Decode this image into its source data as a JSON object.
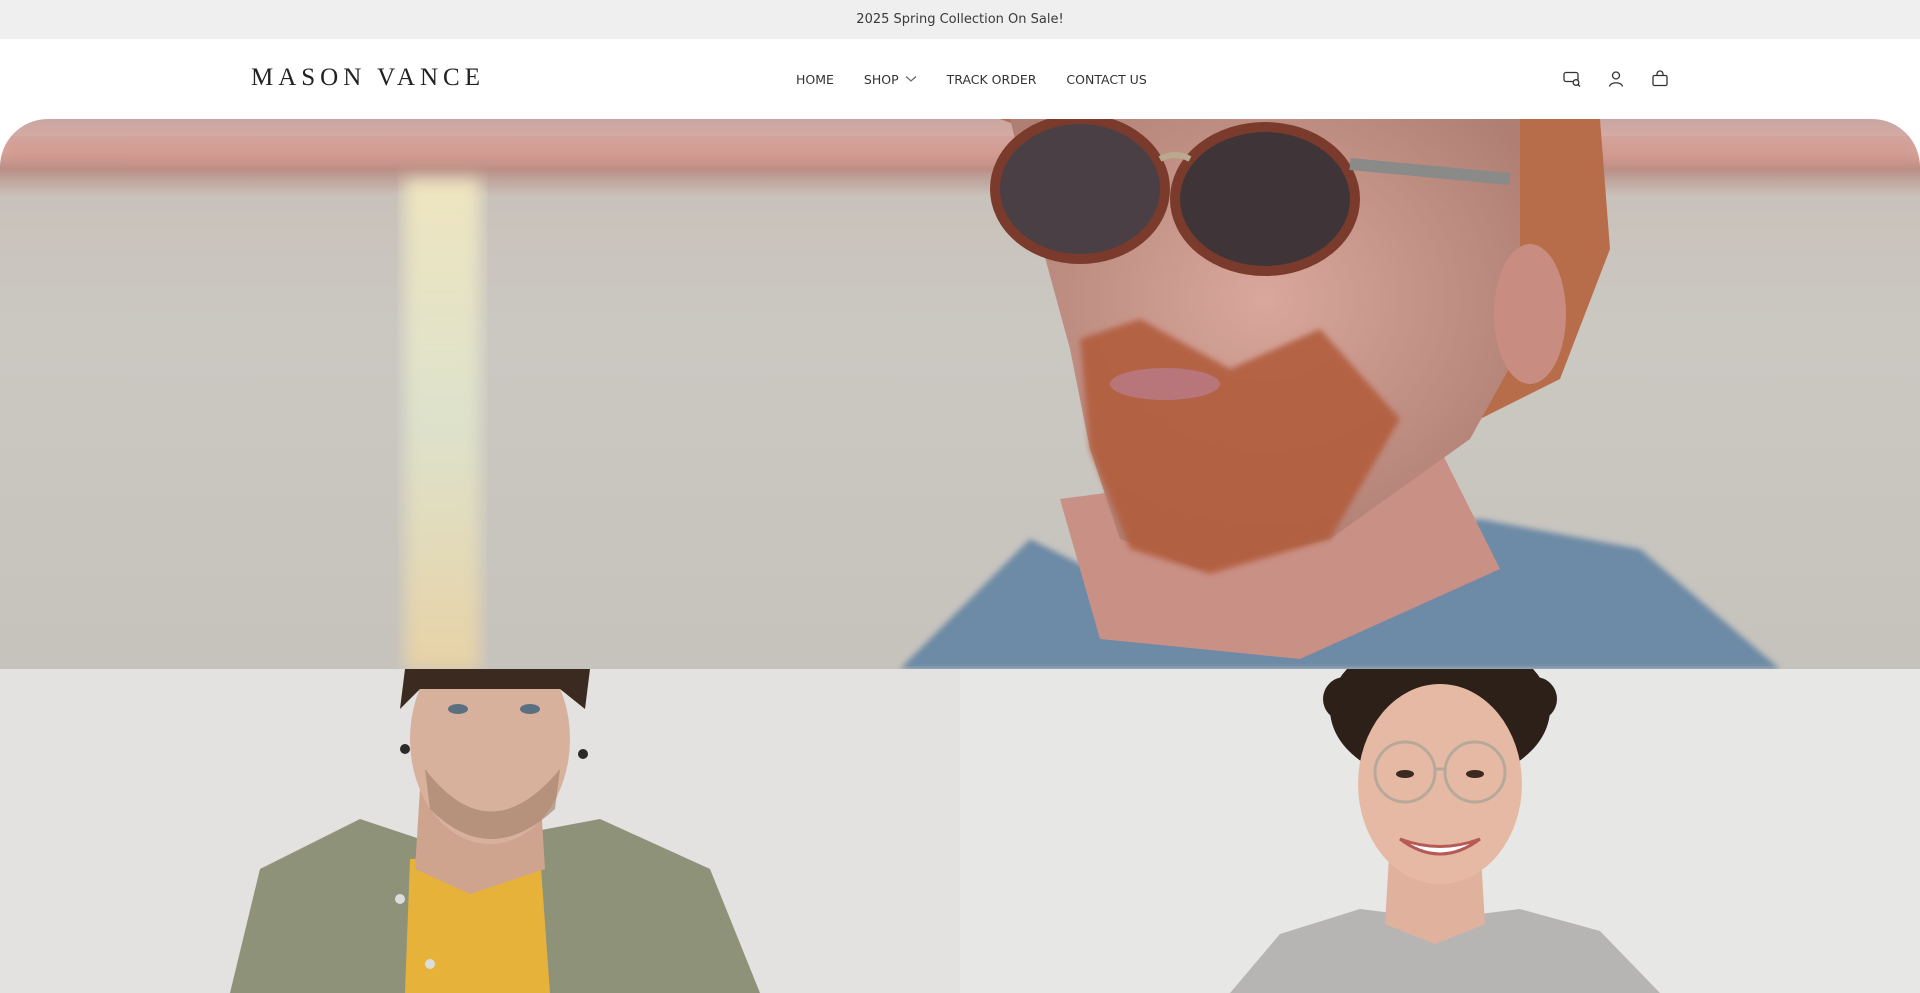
{
  "announcement": {
    "text": "2025 Spring Collection On Sale!"
  },
  "header": {
    "logo": "MASON VANCE",
    "nav": [
      {
        "label": "HOME"
      },
      {
        "label": "SHOP",
        "has_dropdown": true
      },
      {
        "label": "TRACK ORDER"
      },
      {
        "label": "CONTACT US"
      }
    ],
    "icons": [
      "search-icon",
      "account-icon",
      "cart-icon"
    ]
  },
  "hero": {
    "image": "man-with-sunglasses-at-sunset-sea",
    "colors": {
      "sky": "#e0b0a6",
      "sea": "#cbc8c2",
      "hair": "#c96b45"
    }
  },
  "tiles": [
    {
      "image": "man-in-olive-shirt"
    },
    {
      "image": "woman-with-round-glasses-smiling"
    }
  ]
}
